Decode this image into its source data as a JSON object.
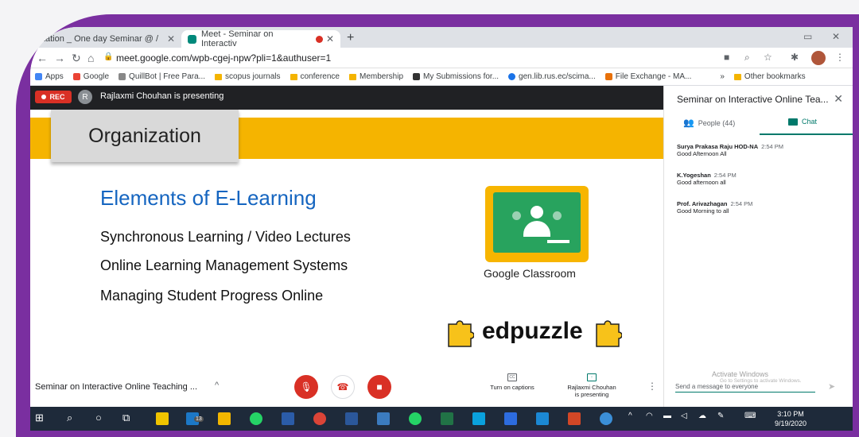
{
  "browser": {
    "tabs": [
      {
        "label": "vitation _ One day Seminar @ /",
        "active": false
      },
      {
        "label": "Meet - Seminar on Interactiv",
        "active": true
      }
    ],
    "new_tab": "+",
    "url": "meet.google.com/wpb-cgej-npw?pli=1&authuser=1",
    "bookmarks": [
      "Apps",
      "Google",
      "QuillBot | Free Para...",
      "scopus journals",
      "conference",
      "Membership",
      "My Submissions for...",
      "gen.lib.rus.ec/scima...",
      "File Exchange - MA...",
      "»",
      "Other bookmarks"
    ]
  },
  "meet": {
    "rec": "REC",
    "presenter_initial": "R",
    "presenting_text": "Rajlaxmi Chouhan is presenting",
    "slide": {
      "header": "Organization",
      "heading": "Elements of E-Learning",
      "items": [
        "Synchronous Learning / Video Lectures",
        "Online Learning Management Systems",
        "Managing Student Progress Online"
      ],
      "classroom_label": "Google Classroom",
      "edpuzzle_label": "edpuzzle"
    },
    "bottom": {
      "meeting_title": "Seminar on Interactive Online Teaching ...",
      "captions": "Turn on captions",
      "presenting_line1": "Rajlaxmi Chouhan",
      "presenting_line2": "is presenting"
    }
  },
  "panel": {
    "title": "Seminar on Interactive Online Tea...",
    "people_tab": "People (44)",
    "chat_tab": "Chat",
    "messages": [
      {
        "sender": "Surya Prakasa Raju HOD-NA",
        "time": "2:54 PM",
        "text": "Good Afternoon All"
      },
      {
        "sender": "K.Yogeshan",
        "time": "2:54 PM",
        "text": "Good afternoon all"
      },
      {
        "sender": "Prof. Arivazhagan",
        "time": "2:54 PM",
        "text": "Good Morning to all"
      }
    ],
    "input_placeholder": "Send a message to everyone",
    "activate_title": "Activate Windows",
    "activate_sub": "Go to Settings to activate Windows."
  },
  "taskbar": {
    "time": "3:10 PM",
    "date": "9/19/2020",
    "badge": "13"
  },
  "colors": {
    "frame": "#7a2fa0",
    "slide_band": "#f5b400",
    "heading_blue": "#1565c0",
    "meet_red": "#d93025",
    "chat_teal": "#00796b",
    "classroom_green": "#28a35e"
  }
}
